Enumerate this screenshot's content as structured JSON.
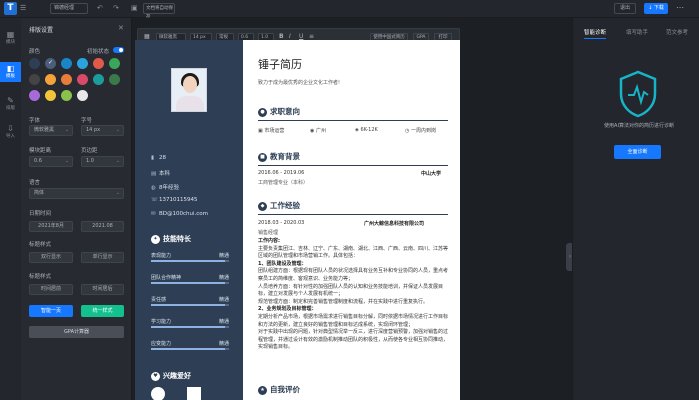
{
  "topbar": {
    "logo": "T",
    "menu_icon": "☰",
    "doc_name": "锦德经理",
    "save_box": "文档将自动保存",
    "exit_label": "退出",
    "download_label": "↓ 下载",
    "more_icon": "⋯"
  },
  "leftnav": [
    {
      "icon": "▦",
      "label": "模块"
    },
    {
      "icon": "◧",
      "label": "模板"
    },
    {
      "icon": "✎",
      "label": "排版"
    },
    {
      "icon": "⇩",
      "label": "导入"
    }
  ],
  "panel": {
    "title": "排版设置",
    "close_icon": "✕",
    "color_label": "颜色",
    "init_state_label": "初始状态",
    "swatch_colors": [
      "#2d3e55",
      "#4a5d7a",
      "#1a86c7",
      "#2aa3e0",
      "#e05a4a",
      "#3aa65a",
      "#444444",
      "#f5a23a",
      "#e87c3a",
      "#d94a6a",
      "#1c9c9c",
      "#3a7a4a",
      "#a66ad9",
      "#f3c43a",
      "#8bc34a",
      "#e8e8e8"
    ],
    "font_label": "字体",
    "font_value": "微软雅黑",
    "size_label": "字号",
    "size_value": "14 px",
    "module_spacing_label": "模块距离",
    "module_spacing_value": "0.6",
    "line_spacing_label": "页边距",
    "line_spacing_value": "1.0",
    "lang_label": "语言",
    "lang_value": "简体",
    "date_label": "日期时间",
    "date_from": "2021年8月",
    "date_to": "2021.08",
    "title_style_label": "标题样式",
    "title_style_a": "双行显示",
    "title_style_b": "单行显示",
    "time_style_label": "标题样式",
    "time_style_a": "时间居前",
    "time_style_b": "时间居后",
    "btn_one_page": "智能一页",
    "btn_unify": "统一样式",
    "btn_gpa": "GPA计算器"
  },
  "fmtbar": {
    "font": "微软雅黑",
    "size": "14 px",
    "weight": "常规",
    "spacing": "0.6",
    "line": "1.0",
    "bold_icon": "B",
    "italic_icon": "I",
    "underline_icon": "U",
    "align_icon": "≡",
    "btn_cn": "使用中国式简历",
    "btn_gpa": "GPA",
    "btn_print": "打印"
  },
  "resume": {
    "name": "锤子简历",
    "motto": "致力于成为最优秀的企业文化工作者!",
    "side_info": [
      {
        "icon": "▮",
        "text": "28"
      },
      {
        "icon": "▤",
        "text": "本科"
      },
      {
        "icon": "◍",
        "text": "8年经验"
      },
      {
        "icon": "☏",
        "text": "13710115945"
      },
      {
        "icon": "✉",
        "text": "BD@100chui.com"
      }
    ],
    "skills_title": "技能特长",
    "skills": [
      {
        "name": "表现能力",
        "level": "精通",
        "pct": 0.95
      },
      {
        "name": "团队合作精神",
        "level": "精通",
        "pct": 0.95
      },
      {
        "name": "责任感",
        "level": "精通",
        "pct": 0.95
      },
      {
        "name": "学习能力",
        "level": "精通",
        "pct": 0.95
      },
      {
        "name": "应变能力",
        "level": "精通",
        "pct": 0.95
      }
    ],
    "hobby_title": "兴趣爱好",
    "intent_title": "求职意向",
    "intent": {
      "job": "市场运营",
      "city": "广州",
      "salary": "6K-12K",
      "arrival": "一周内到岗"
    },
    "edu_title": "教育背景",
    "edu": {
      "period": "2016.06 - 2019.06",
      "school": "中山大学",
      "major": "工商管理专业（本科）"
    },
    "work_title": "工作经验",
    "work": {
      "period": "2018.03 - 2020.03",
      "company": "广州大鲸信息科技有限公司",
      "role": "销售经理",
      "content_head": "工作内容:",
      "p1": "主要负责集团江、吉林、辽宁、广东、湖南、湖北、江西、广西、云南、四川、江苏等区域的团队管理和市场营销工作。具体包括：",
      "h1": "1、团队建设及管理：",
      "p2": "团队组建方面：根据现有团队人员的状况选择具有业务互补和专业协同的人员，重点考察员工的简维度、客观意识、业务能力等；",
      "p3": "人员培养方面：有针对性的加强团队人员的认知和业务技能培训，并保证人员发展目标，建立对发展与个人发展有机统一；",
      "p4": "规范管理方面：制定和完善销售管理制度和流程，并在实践中进行重复执行。",
      "h2": "2、业务规划及目标管理：",
      "p5": "定期分析产品市场，根据市场需求进行销售目标分解，同时依据市场情况进行工作目标和方法的更新，建立良好的销售管理和目标达成系统，实现闭环管理；",
      "p6": "对于实践中出现的问题，针对典型情况举一反三，进行深度营销预警，加强对销售的过程管理，并通过设计有效的激励机制推动团队的积极性，从而使各专业相互协同推动，实现销售目标。"
    },
    "self_title": "自我评价"
  },
  "rpanel": {
    "tab1": "智能诊断",
    "tab2": "填写助手",
    "tab3": "范文参考",
    "desc": "使用AI算法对你的简历进行诊断",
    "btn": "全面诊断",
    "handle": "›"
  }
}
